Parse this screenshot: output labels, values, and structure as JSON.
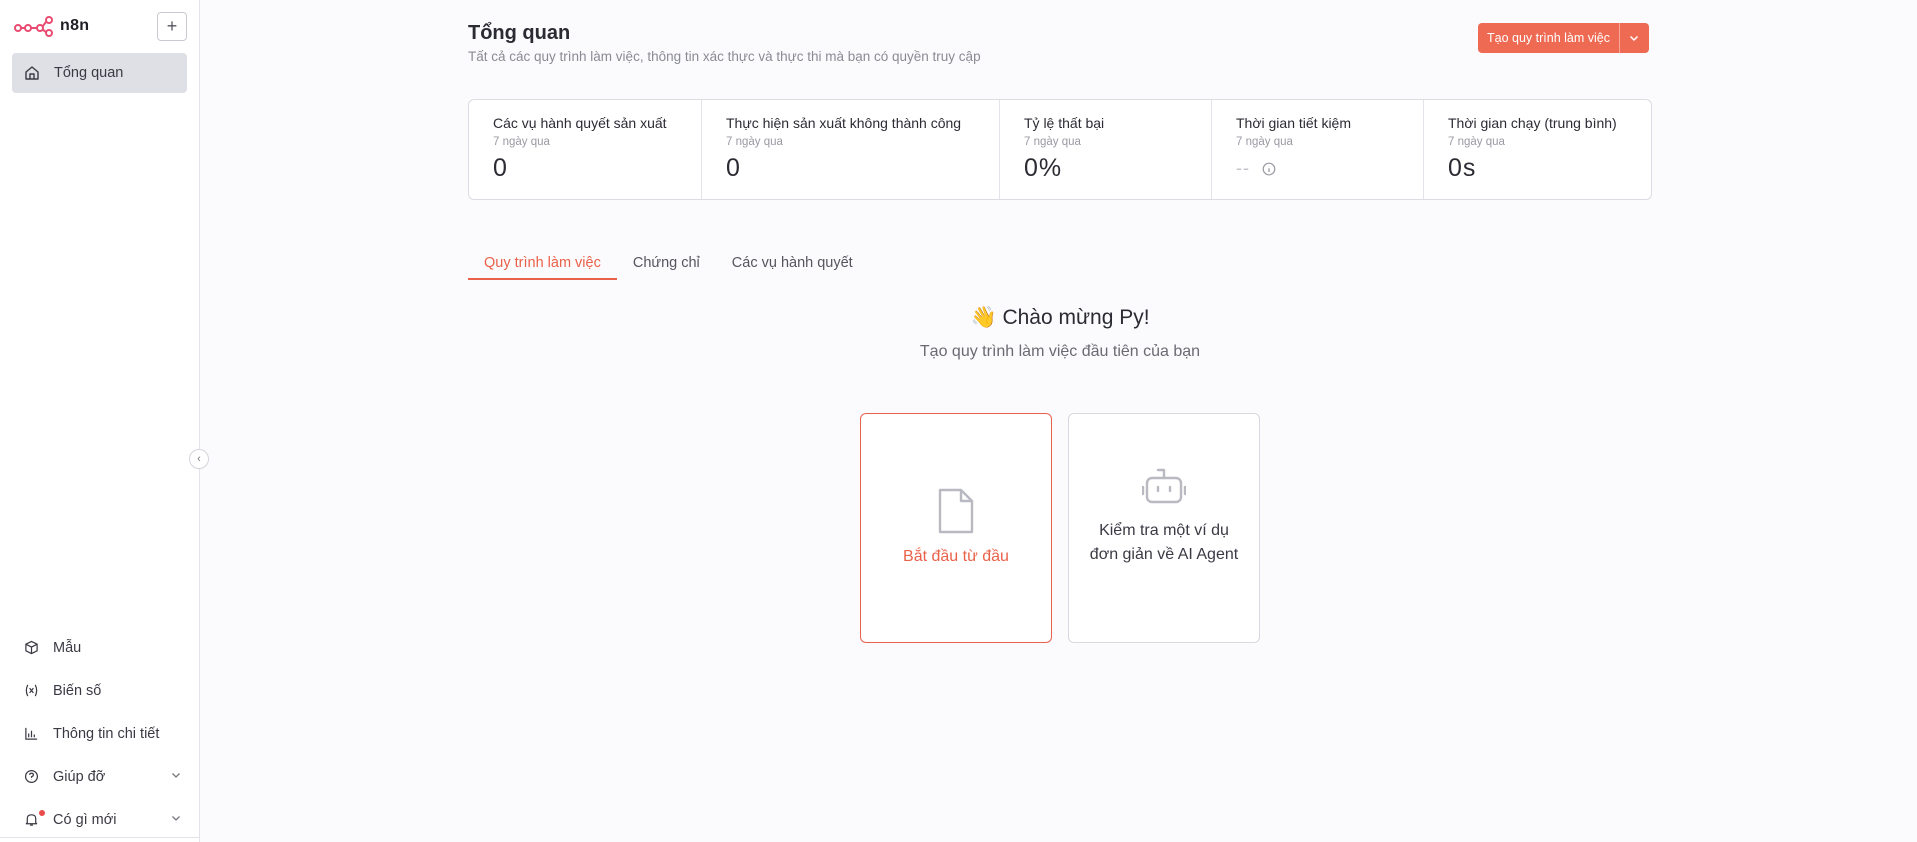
{
  "app": {
    "name": "n8n"
  },
  "sidebar": {
    "overview_label": "Tổng quan",
    "bottom_items": [
      {
        "label": "Mẫu",
        "icon": "box-icon"
      },
      {
        "label": "Biến số",
        "icon": "variable-icon"
      },
      {
        "label": "Thông tin chi tiết",
        "icon": "chart-icon"
      },
      {
        "label": "Giúp đỡ",
        "icon": "help-icon"
      },
      {
        "label": "Có gì mới",
        "icon": "bell-icon"
      }
    ]
  },
  "header": {
    "title": "Tổng quan",
    "subtitle": "Tất cả các quy trình làm việc, thông tin xác thực và thực thi mà bạn có quyền truy cập",
    "create_button": "Tạo quy trình làm việc"
  },
  "stats": [
    {
      "label": "Các vụ hành quyết sản xuất",
      "period": "7 ngày qua",
      "value": "0"
    },
    {
      "label": "Thực hiện sản xuất không thành công",
      "period": "7 ngày qua",
      "value": "0"
    },
    {
      "label": "Tỷ lệ thất bại",
      "period": "7 ngày qua",
      "value": "0%"
    },
    {
      "label": "Thời gian tiết kiệm",
      "period": "7 ngày qua",
      "value": "--"
    },
    {
      "label": "Thời gian chạy (trung bình)",
      "period": "7 ngày qua",
      "value": "0s"
    }
  ],
  "tabs": [
    "Quy trình làm việc",
    "Chứng chỉ",
    "Các vụ hành quyết"
  ],
  "welcome": {
    "emoji": "👋",
    "title": "Chào mừng Py!",
    "subtitle": "Tạo quy trình làm việc đầu tiên của bạn"
  },
  "cards": {
    "scratch": "Bắt đầu từ đầu",
    "ai": "Kiểm tra một ví dụ đơn giản về AI Agent"
  },
  "colors": {
    "accent": "#ea6149",
    "button": "#ee6a53"
  }
}
